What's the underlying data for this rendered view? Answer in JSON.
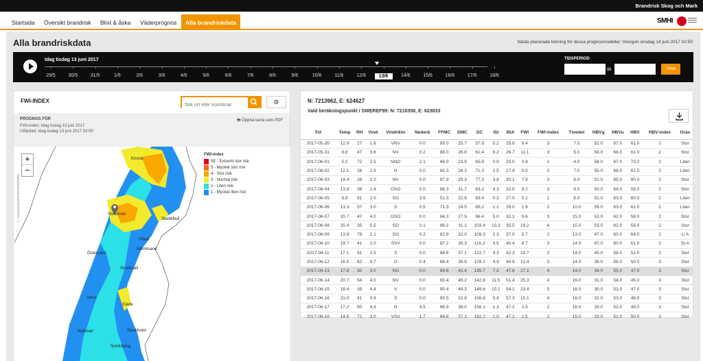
{
  "header": {
    "site_title": "Brandrisk Skog och Mark",
    "smhi_logo": "SMHI"
  },
  "nav": {
    "tabs": [
      "Startsida",
      "Översikt brandrisk",
      "Blixt & åska",
      "Väderprognos",
      "Alla brandriskdata"
    ],
    "active_index": 4
  },
  "page": {
    "title": "Alla brandriskdata",
    "next_run": "Nästa planerade körning för dessa prognosmodeller: Imorgon onsdag 14 juni 2017 02:50"
  },
  "timeline": {
    "current_label": "Idag tisdag 13 juni 2017",
    "dates": [
      "29/5",
      "30/5",
      "31/5",
      "1/6",
      "2/6",
      "3/6",
      "4/6",
      "5/6",
      "6/6",
      "7/6",
      "8/6",
      "9/6",
      "10/6",
      "11/6",
      "12/6",
      "13/6",
      "14/6",
      "15/6",
      "16/6",
      "17/6",
      "18/6"
    ],
    "selected": "13/6",
    "tidsperiod_label": "TIDSPERIOD",
    "till_label": "till",
    "visa_button": "Visa"
  },
  "left": {
    "title": "FWI-INDEX",
    "search_placeholder": "Sök ort eller koordinat",
    "prognos_heading": "PROGNOS FÖR",
    "fwi_index_line": "FWI-index: Idag tisdag 13 juni 2017",
    "utfardad_line": "Utfärdad: Idag tisdag 13 juni 2017 02:50",
    "pdf_link": "Öppna karta som PDF",
    "zoom_in": "+",
    "zoom_out": "−",
    "copyright": "© Lantmäteriverket MS2009/07950",
    "legend_title": "FWI-index",
    "legend": [
      {
        "label": "5E - Extremt stor risk",
        "color": "#e8001c"
      },
      {
        "label": "5 - Mycket stor risk",
        "color": "#f46b14"
      },
      {
        "label": "4 - Stor risk",
        "color": "#f8a800"
      },
      {
        "label": "3 - Normal risk",
        "color": "#f3ea2d"
      },
      {
        "label": "2 - Liten risk",
        "color": "#2ce0e8"
      },
      {
        "label": "1 - Mycket liten risk",
        "color": "#2290f0"
      }
    ],
    "cities": [
      "Kiruna",
      "Storuman",
      "Skellefteå",
      "Piteå",
      "Östersund",
      "Härnösand",
      "Sundsvall",
      "Mora",
      "Gävle",
      "Karlstad",
      "Stockholm",
      "Norrköping"
    ]
  },
  "right": {
    "coord": "N: 7213962, E: 624627",
    "point": "Vald beräkningspunkt i SWEREF99: N: 7210358, E: 623833",
    "columns": [
      "Tid",
      "Temp",
      "RH",
      "Vind",
      "Vindriktn",
      "Nederb",
      "FFMC",
      "DMC",
      "DC",
      "ISI",
      "BUI",
      "FWI",
      "FWI-index",
      "Tmedel",
      "HBVg",
      "HBVu",
      "HBV",
      "HBV-index",
      "Gräs"
    ],
    "rows": [
      [
        "2017-05-30",
        "12.9",
        "27",
        "1.8",
        "VNV",
        "0.0",
        "89.0",
        "25.7",
        "57.8",
        "5.2",
        "25.6",
        "9.4",
        "3",
        "7.0",
        "52.0",
        "67.0",
        "61.0",
        "2",
        "Stor"
      ],
      [
        "2017-05-31",
        "6.8",
        "47",
        "3.6",
        "NV",
        "0.2",
        "88.0",
        "26.8",
        "61.4",
        "6.2",
        "26.7",
        "11.1",
        "3",
        "5.0",
        "58.0",
        "68.0",
        "61.0",
        "2",
        "Stor"
      ],
      [
        "2017-06-01",
        "5.2",
        "72",
        "2.5",
        "NNO",
        "2.1",
        "66.0",
        "23.9",
        "65.8",
        "0.9",
        "25.0",
        "0.9",
        "1",
        "4.0",
        "58.0",
        "67.0",
        "73.0",
        "2",
        "Liten"
      ],
      [
        "2017-06-02",
        "12.1",
        "28",
        "2.9",
        "N",
        "0.0",
        "82.3",
        "26.3",
        "71.3",
        "2.5",
        "27.4",
        "5.0",
        "2",
        "7.0",
        "55.0",
        "66.0",
        "61.0",
        "2",
        "Liten"
      ],
      [
        "2017-06-03",
        "14.4",
        "28",
        "1.0",
        "NV",
        "0.0",
        "87.9",
        "29.3",
        "77.3",
        "3.8",
        "30.1",
        "7.9",
        "3",
        "8.0",
        "52.0",
        "65.0",
        "60.0",
        "2",
        "Stor"
      ],
      [
        "2017-06-04",
        "13.9",
        "38",
        "1.4",
        "OSO",
        "0.0",
        "88.3",
        "31.7",
        "83.2",
        "4.3",
        "32.5",
        "9.2",
        "3",
        "9.0",
        "50.0",
        "64.0",
        "58.0",
        "2",
        "Stor"
      ],
      [
        "2017-06-05",
        "8.9",
        "81",
        "2.0",
        "SO",
        "3.9",
        "51.3",
        "22.8",
        "83.4",
        "0.3",
        "27.5",
        "0.1",
        "1",
        "8.0",
        "52.0",
        "63.0",
        "60.0",
        "2",
        "Liten"
      ],
      [
        "2017-06-06",
        "13.3",
        "57",
        "3.0",
        "S",
        "0.5",
        "71.3",
        "24.5",
        "89.2",
        "1.1",
        "29.0",
        "1.9",
        "2",
        "10.0",
        "59.0",
        "63.0",
        "61.0",
        "2",
        "Liten"
      ],
      [
        "2017-06-07",
        "20.7",
        "47",
        "4.0",
        "OSO",
        "0.0",
        "84.3",
        "27.5",
        "96.4",
        "5.0",
        "32.1",
        "9.6",
        "3",
        "15.0",
        "53.0",
        "62.0",
        "58.0",
        "2",
        "Stor"
      ],
      [
        "2017-06-08",
        "20.4",
        "35",
        "5.5",
        "SO",
        "0.1",
        "89.2",
        "31.1",
        "103.4",
        "10.3",
        "35.5",
        "19.2",
        "4",
        "15.0",
        "53.0",
        "62.0",
        "58.0",
        "2",
        "Stor"
      ],
      [
        "2017-06-09",
        "13.9",
        "78",
        "2.1",
        "SO",
        "0.2",
        "82.9",
        "32.0",
        "109.3",
        "2.3",
        "37.0",
        "5.7",
        "2",
        "13.0",
        "47.0",
        "60.0",
        "64.0",
        "2",
        "Li A"
      ],
      [
        "2017-06-10",
        "19.7",
        "41",
        "1.0",
        "SSV",
        "0.0",
        "87.2",
        "35.3",
        "116.2",
        "3.5",
        "40.4",
        "8.7",
        "3",
        "14.0",
        "47.0",
        "60.0",
        "61.0",
        "2",
        "St A"
      ],
      [
        "2017-06-11",
        "17.1",
        "61",
        "2.5",
        "S",
        "0.0",
        "86.8",
        "37.1",
        "122.7",
        "4.3",
        "42.3",
        "10.7",
        "3",
        "14.0",
        "40.0",
        "58.0",
        "51.0",
        "2",
        "Slut"
      ],
      [
        "2017-06-12",
        "16.5",
        "62",
        "4.7",
        "O",
        "0.4",
        "86.4",
        "38.9",
        "129.1",
        "4.9",
        "44.8",
        "12.4",
        "3",
        "14.0",
        "38.0",
        "56.0",
        "50.0",
        "3",
        "Slut"
      ],
      [
        "2017-06-13",
        "17.8",
        "30",
        "3.0",
        "NO",
        "0.0",
        "89.8",
        "42.4",
        "135.7",
        "7.2",
        "47.6",
        "17.1",
        "4",
        "14.0",
        "34.0",
        "55.0",
        "47.0",
        "3",
        "Slut"
      ],
      [
        "2017-06-14",
        "20.7",
        "54",
        "4.0",
        "NV",
        "0.0",
        "90.4",
        "46.2",
        "142.8",
        "11.5",
        "51.4",
        "25.3",
        "4",
        "16.0",
        "31.0",
        "54.0",
        "45.0",
        "3",
        "Slut"
      ],
      [
        "2017-06-15",
        "18.4",
        "39",
        "4.4",
        "V",
        "0.0",
        "90.4",
        "49.3",
        "149.6",
        "10.1",
        "54.1",
        "23.4",
        "5",
        "16.0",
        "30.0",
        "53.0",
        "47.0",
        "3",
        "Slut"
      ],
      [
        "2017-06-16",
        "21.0",
        "41",
        "0.9",
        "S",
        "0.0",
        "90.5",
        "52.8",
        "156.8",
        "5.4",
        "57.3",
        "15.1",
        "4",
        "16.0",
        "32.0",
        "53.0",
        "48.0",
        "3",
        "Slut"
      ],
      [
        "2017-06-17",
        "17.2",
        "60",
        "4.4",
        "N",
        "4.5",
        "66.9",
        "38.0",
        "156.1",
        "1.3",
        "47.2",
        "2.5",
        "2",
        "16.0",
        "29.0",
        "52.0",
        "48.0",
        "3",
        "Slut"
      ],
      [
        "2017-06-18",
        "14.8",
        "72",
        "3.0",
        "VSV",
        "1.7",
        "66.6",
        "37.1",
        "162.2",
        "1.0",
        "47.2",
        "2.5",
        "2",
        "15.0",
        "29.0",
        "51.0",
        "50.0",
        "3",
        "Slut"
      ]
    ],
    "highlight_row": 14
  }
}
